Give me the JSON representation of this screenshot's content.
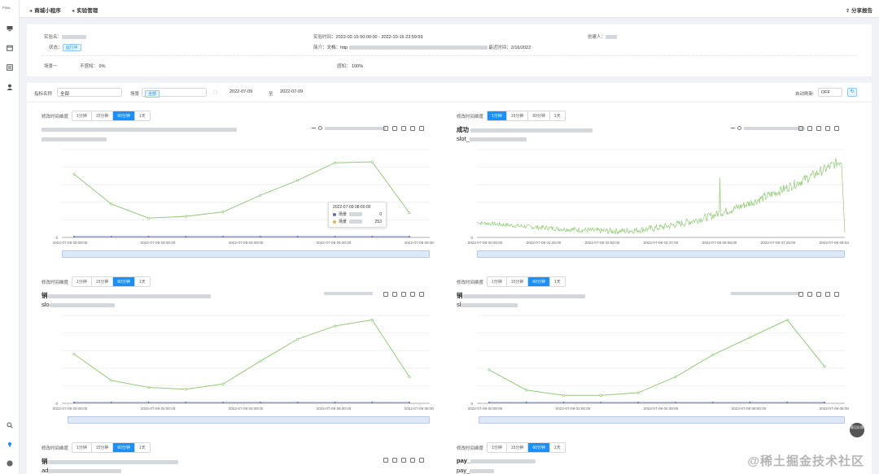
{
  "rail": {
    "logo": "Flow"
  },
  "breadcrumbs": [
    {
      "label": "商城小程序"
    },
    {
      "label": "实验管理"
    }
  ],
  "share_label": "分享报告",
  "info": {
    "exp_name_label": "实验名：",
    "status_label": "状态：",
    "status_value": "运行中",
    "time_label": "实验时间：",
    "time_value": "2022-02-15 00:00:00 - 2022-10-16 23:59:59",
    "desc_label": "简介：",
    "desc_value": "文档：http",
    "last_label": "最近时间：",
    "last_value": "2/16/2022",
    "creator_label": "创建人：",
    "scene_label": "场景一",
    "scene_value_label": "不感知：",
    "scene_value": "0%",
    "sense_label": "感知：",
    "sense_value": "100%"
  },
  "filters": {
    "metric_label": "指标名称",
    "metric_value": "全部",
    "scene_label": "场景",
    "scene_value": "全部",
    "date_from": "2022-07-09",
    "date_to_sep": "至",
    "date_to": "2022-07-09",
    "auto_refresh_label": "自动刷新",
    "auto_refresh_value": "OFF"
  },
  "granularity_label": "修改时间维度",
  "granularity_options": [
    "1分钟",
    "15分钟",
    "60分钟",
    "1天"
  ],
  "cards": [
    {
      "title": "",
      "subtitle": "",
      "active": 2,
      "x_ticks": [
        "2022-07-09 00:00:00",
        "2022-07-09 02:00:00",
        "2022-07-09 04:00:00",
        "2022-07-09 06:00:00",
        "2022-07-09 08:00:00"
      ]
    },
    {
      "title": "成功",
      "subtitle": "slot_",
      "active": 0,
      "x_ticks": [
        "2022-07-09 00:00:00",
        "2022-07-09 01:25:00",
        "2022-07-09 02:58:00",
        "2022-07-09 04:27:00",
        "2022-07-09 05:56:00",
        "2022-07-09 07:25:00",
        "2022-07-09 08:54:00"
      ]
    },
    {
      "title": "销",
      "subtitle": "slo",
      "active": 2,
      "x_ticks": [
        "2022-07-09 00:00:00",
        "2022-07-09 02:00:00",
        "2022-07-09 04:00:00",
        "2022-07-09 06:00:00",
        "2022-07-09 08:00:00"
      ]
    },
    {
      "title": "销",
      "subtitle": "sl",
      "active": 2,
      "x_ticks": [
        "2022-07-09 00:00:00",
        "2022-07-09 02:00:00",
        "2022-07-09 04:00:00",
        "2022-07-09 06:00:00",
        "2022-07-09 08:00:00"
      ]
    },
    {
      "title": "销",
      "subtitle": "ad",
      "active": 2
    },
    {
      "title": "pay_",
      "subtitle": "pay_",
      "active": 2
    }
  ],
  "tooltip": {
    "time": "2022-07-09 08:00:00",
    "rows": [
      {
        "label": "场景",
        "value": "0",
        "color": "#5470c6"
      },
      {
        "label": "场景",
        "value": "253",
        "color": "#e0b552"
      }
    ]
  },
  "help_label": "意见反馈",
  "watermark": "@稀土掘金技术社区",
  "colors": {
    "series": "#91cc75",
    "accent": "#1890ff",
    "baseline": "#5470c6"
  },
  "chart_data": [
    {
      "type": "line",
      "x": [
        "00:00",
        "01:00",
        "02:00",
        "03:00",
        "04:00",
        "05:00",
        "06:00",
        "07:00",
        "08:00",
        "09:00"
      ],
      "series": [
        {
          "values": [
            0.72,
            0.38,
            0.22,
            0.24,
            0.29,
            0.48,
            0.65,
            0.85,
            0.86,
            0.28
          ]
        },
        {
          "values": [
            0,
            0,
            0,
            0,
            0,
            0,
            0,
            0,
            0,
            0
          ]
        }
      ]
    },
    {
      "type": "line",
      "x_count": 540,
      "series": [
        {
          "name": "",
          "profile": "u-shaped-noisy"
        }
      ]
    },
    {
      "type": "line",
      "x": [
        "00:00",
        "01:00",
        "02:00",
        "03:00",
        "04:00",
        "05:00",
        "06:00",
        "07:00",
        "08:00",
        "09:00"
      ],
      "series": [
        {
          "values": [
            0.56,
            0.26,
            0.18,
            0.16,
            0.22,
            0.48,
            0.73,
            0.88,
            0.95,
            0.3
          ]
        },
        {
          "values": [
            0,
            0,
            0,
            0,
            0,
            0,
            0,
            0,
            0,
            0
          ]
        }
      ]
    },
    {
      "type": "line",
      "x": [
        "00:00",
        "01:00",
        "02:00",
        "03:00",
        "04:00",
        "05:00",
        "06:00",
        "07:00",
        "08:00",
        "09:00"
      ],
      "series": [
        {
          "values": [
            0.38,
            0.15,
            0.09,
            0.09,
            0.12,
            0.3,
            0.55,
            0.75,
            0.95,
            0.42
          ]
        },
        {
          "values": [
            0,
            0,
            0,
            0,
            0,
            0,
            0,
            0,
            0,
            0
          ]
        }
      ]
    }
  ]
}
